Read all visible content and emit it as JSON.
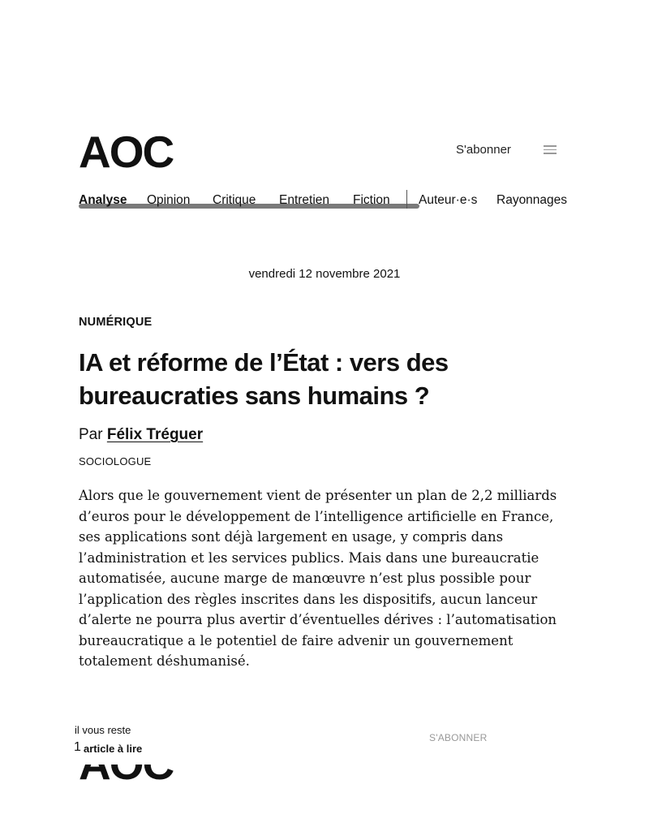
{
  "header": {
    "logo": "AOC",
    "subscribe_label": "S'abonner",
    "menu_icon": "hamburger-icon"
  },
  "nav": {
    "items": [
      {
        "label": "Analyse",
        "active": true
      },
      {
        "label": "Opinion",
        "active": false
      },
      {
        "label": "Critique",
        "active": false
      },
      {
        "label": "Entretien",
        "active": false
      },
      {
        "label": "Fiction",
        "active": false
      },
      {
        "label": "Auteur·e·s",
        "active": false
      },
      {
        "label": "Rayonnages",
        "active": false
      }
    ]
  },
  "article": {
    "date": "vendredi 12 novembre 2021",
    "category": "NUMÉRIQUE",
    "title": "IA et réforme de l’État : vers des bureaucraties sans humains ?",
    "byline_prefix": "Par",
    "author": "Félix Tréguer",
    "author_role": "SOCIOLOGUE",
    "lede": "Alors que le gouvernement vient de présenter un plan de 2,2 milliards d’euros pour le développement de l’intelligence artificielle en France, ses applications sont déjà largement en usage, y compris dans l’administration et les services publics. Mais dans une bureaucratie automatisée, aucune marge de manœuvre n’est plus possible pour l’application des règles inscrites dans les dispositifs, aucun lanceur d’alerte ne pourra plus avertir d’éventuelles dérives : l’automatisation bureaucratique a le potentiel de faire advenir un gouvernement totalement déshumanisé."
  },
  "paywall": {
    "logo": "AOC",
    "remaining_label": "il vous reste",
    "remaining_count": "1",
    "remaining_text": "article à lire",
    "subscribe_label": "S'ABONNER"
  },
  "colors": {
    "text": "#111111",
    "muted": "#999999",
    "scrollbar": "#7a7a7a",
    "background": "#ffffff"
  }
}
